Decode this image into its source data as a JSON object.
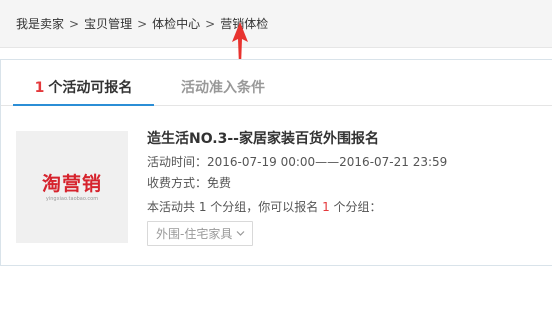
{
  "breadcrumb": {
    "items": [
      "我是卖家",
      "宝贝管理",
      "体检中心",
      "营销体检"
    ],
    "separator": ">"
  },
  "tabs": {
    "active": {
      "count": "1",
      "label": "个活动可报名"
    },
    "inactive": {
      "label": "活动准入条件"
    }
  },
  "activity": {
    "logo": {
      "text": "淘营销",
      "subtext": "yingxiao.taobao.com"
    },
    "title": "造生活NO.3--家居家装百货外围报名",
    "time_label": "活动时间：",
    "time_value": "2016-07-19 00:00——2016-07-21 23:59",
    "fee_label": "收费方式：",
    "fee_value": "免费",
    "groups_prefix": "本活动共 1 个分组，你可以报名 ",
    "groups_count": "1",
    "groups_suffix": " 个分组：",
    "select": {
      "selected": "外围-住宅家具"
    }
  },
  "colors": {
    "accent_blue": "#2b8ed6",
    "accent_red": "#e4393c",
    "arrow_red": "#e8332f",
    "logo_red": "#d6232d"
  },
  "icons": {
    "annotation_arrow": "arrow-up-icon",
    "select_chevron": "chevron-down-icon"
  }
}
